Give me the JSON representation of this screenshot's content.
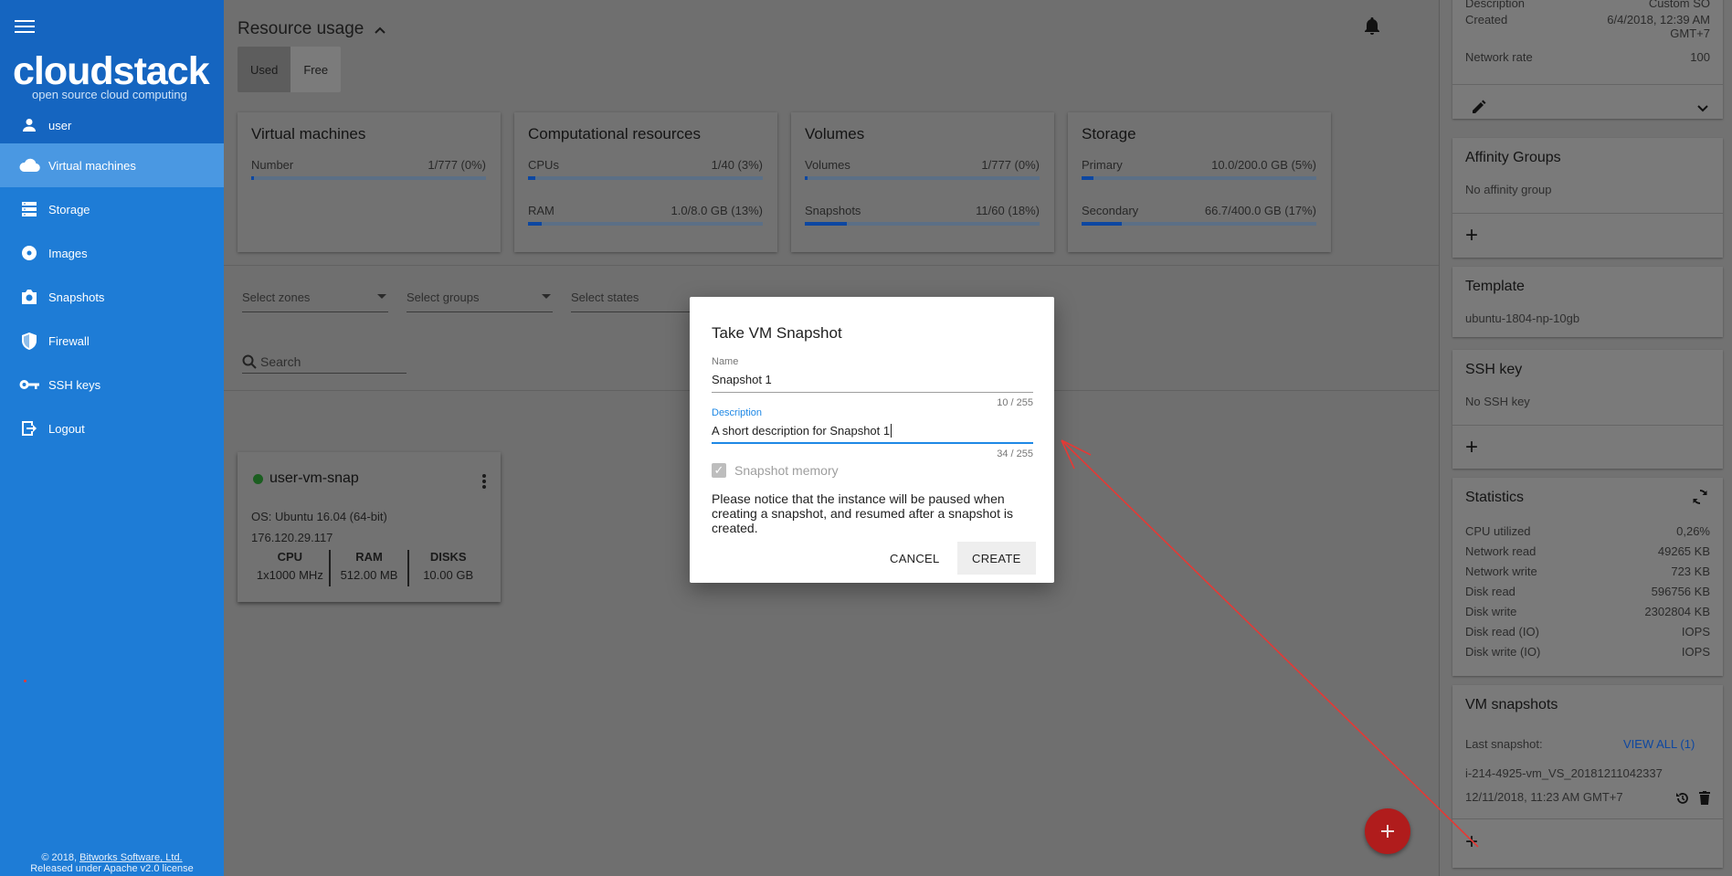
{
  "sidebar": {
    "logo": "cloudstack",
    "logo_sub": "open source cloud computing",
    "user": "user",
    "items": [
      {
        "label": "Virtual machines",
        "icon": "cloud-icon"
      },
      {
        "label": "Storage",
        "icon": "storage-icon"
      },
      {
        "label": "Images",
        "icon": "disc-icon"
      },
      {
        "label": "Snapshots",
        "icon": "camera-icon"
      },
      {
        "label": "Firewall",
        "icon": "shield-icon"
      },
      {
        "label": "SSH keys",
        "icon": "key-icon"
      },
      {
        "label": "Logout",
        "icon": "logout-icon"
      }
    ],
    "footer_line1_prefix": "© 2018, ",
    "footer_company": "Bitworks Software, Ltd.",
    "footer_line2": "Released under Apache v2.0 license"
  },
  "resource_usage": {
    "title": "Resource usage",
    "toggle": {
      "used": "Used",
      "free": "Free"
    },
    "cards": [
      {
        "title": "Virtual machines",
        "rows": [
          {
            "label": "Number",
            "value": "1/777 (0%)",
            "fraction": 0.005
          }
        ]
      },
      {
        "title": "Computational resources",
        "rows": [
          {
            "label": "CPUs",
            "value": "1/40 (3%)",
            "fraction": 0.03
          },
          {
            "label": "RAM",
            "value": "1.0/8.0 GB (13%)",
            "fraction": 0.06
          }
        ]
      },
      {
        "title": "Volumes",
        "rows": [
          {
            "label": "Volumes",
            "value": "1/777 (0%)",
            "fraction": 0.005
          },
          {
            "label": "Snapshots",
            "value": "11/60 (18%)",
            "fraction": 0.18
          }
        ]
      },
      {
        "title": "Storage",
        "rows": [
          {
            "label": "Primary",
            "value": "10.0/200.0 GB (5%)",
            "fraction": 0.05
          },
          {
            "label": "Secondary",
            "value": "66.7/400.0 GB (17%)",
            "fraction": 0.17
          }
        ]
      }
    ]
  },
  "filters": {
    "zones": "Select zones",
    "groups": "Select groups",
    "states": "Select states",
    "search_placeholder": "Search"
  },
  "vm": {
    "name": "user-vm-snap",
    "os": "OS: Ubuntu 16.04 (64-bit)",
    "ip": "176.120.29.117",
    "specs": [
      {
        "label": "CPU",
        "value": "1x1000 MHz"
      },
      {
        "label": "RAM",
        "value": "512.00 MB"
      },
      {
        "label": "DISKS",
        "value": "10.00 GB"
      }
    ]
  },
  "dialog": {
    "title": "Take VM Snapshot",
    "name_label": "Name",
    "name_value": "Snapshot 1",
    "name_counter": "10 / 255",
    "desc_label": "Description",
    "desc_value": "A short description for Snapshot 1",
    "desc_counter": "34 / 255",
    "checkbox_label": "Snapshot memory",
    "notice": "Please notice that the instance will be paused when creating a snapshot, and resumed after a snapshot is created.",
    "cancel": "CANCEL",
    "create": "CREATE"
  },
  "details": {
    "top": [
      {
        "k": "Description",
        "v": "Custom SO"
      },
      {
        "k": "Created",
        "v": "6/4/2018, 12:39 AM GMT+7"
      },
      {
        "k": "Network rate",
        "v": "100"
      }
    ],
    "affinity_title": "Affinity Groups",
    "affinity_text": "No affinity group",
    "template_title": "Template",
    "template_text": "ubuntu-1804-np-10gb",
    "ssh_title": "SSH key",
    "ssh_text": "No SSH key",
    "stats_title": "Statistics",
    "stats": [
      {
        "k": "CPU utilized",
        "v": "0,26%"
      },
      {
        "k": "Network read",
        "v": "49265 KB"
      },
      {
        "k": "Network write",
        "v": "723 KB"
      },
      {
        "k": "Disk read",
        "v": "596756 KB"
      },
      {
        "k": "Disk write",
        "v": "2302804 KB"
      },
      {
        "k": "Disk read (IO)",
        "v": "IOPS"
      },
      {
        "k": "Disk write (IO)",
        "v": "IOPS"
      }
    ],
    "snap_title": "VM snapshots",
    "snap_last_label": "Last snapshot:",
    "snap_view_all": "VIEW ALL (1)",
    "snap_name": "i-214-4925-vm_VS_20181211042337",
    "snap_date": "12/11/2018, 11:23 AM GMT+7"
  },
  "colors": {
    "sidebar": "#1e7cd6",
    "accent": "#1e88e5",
    "fab": "#d32f2f",
    "annotation": "#e53935"
  }
}
